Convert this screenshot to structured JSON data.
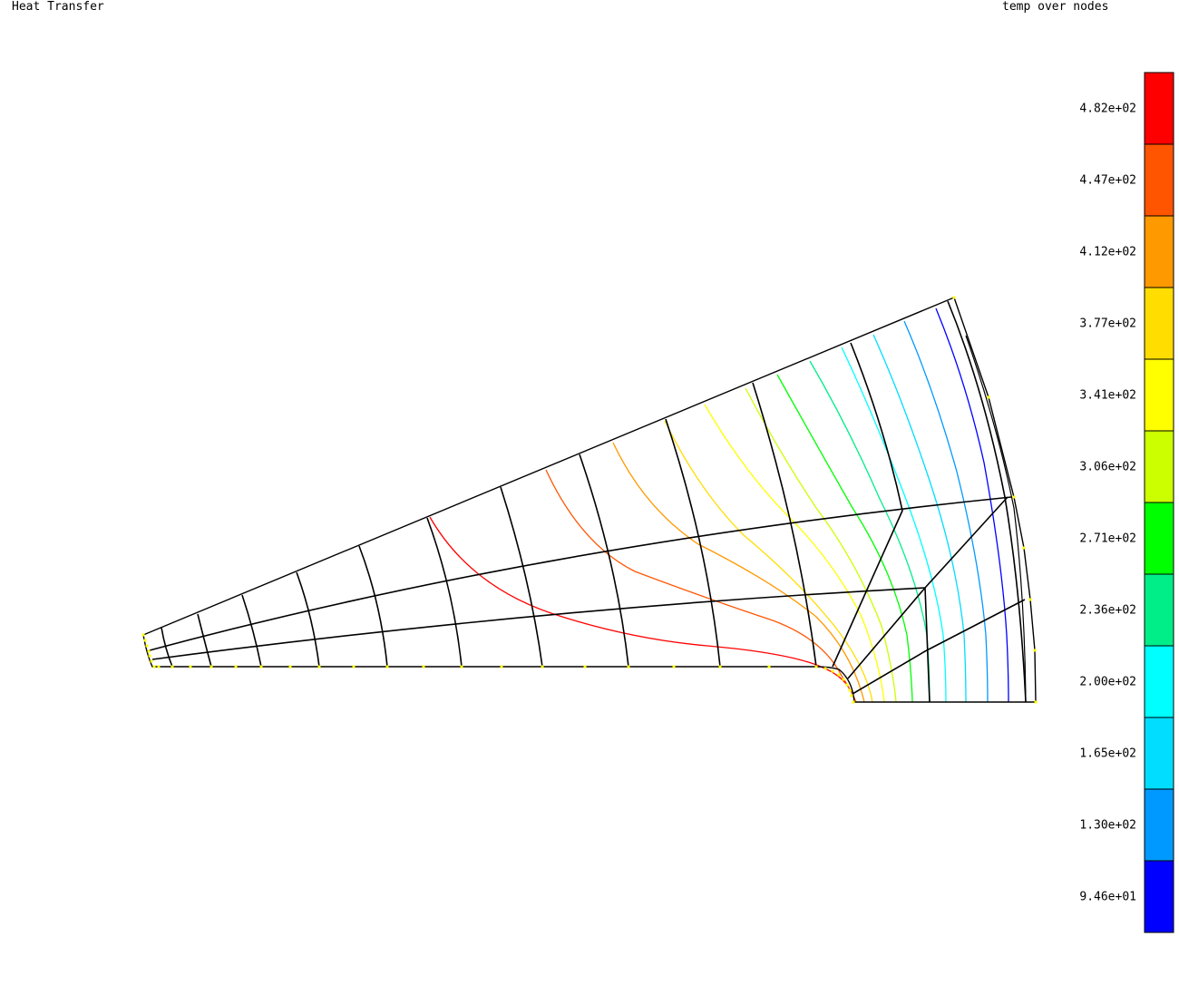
{
  "header": {
    "title": "Heat Transfer",
    "result_label": "temp over nodes"
  },
  "legend": {
    "bands": [
      {
        "color": "#ff0000",
        "label": "4.82e+02"
      },
      {
        "color": "#ff5500",
        "label": "4.47e+02"
      },
      {
        "color": "#ff9900",
        "label": "4.12e+02"
      },
      {
        "color": "#ffdd00",
        "label": "3.77e+02"
      },
      {
        "color": "#ffff00",
        "label": "3.41e+02"
      },
      {
        "color": "#ccff00",
        "label": "3.06e+02"
      },
      {
        "color": "#00ff00",
        "label": "2.71e+02"
      },
      {
        "color": "#00ee88",
        "label": "2.36e+02"
      },
      {
        "color": "#00ffff",
        "label": "2.00e+02"
      },
      {
        "color": "#00ddff",
        "label": "1.65e+02"
      },
      {
        "color": "#0099ff",
        "label": "1.30e+02"
      },
      {
        "color": "#0000ff",
        "label": "9.46e+01"
      }
    ]
  },
  "colors": {
    "mesh": "#000000",
    "node_marker": "#ffff00",
    "background": "#ffffff"
  }
}
